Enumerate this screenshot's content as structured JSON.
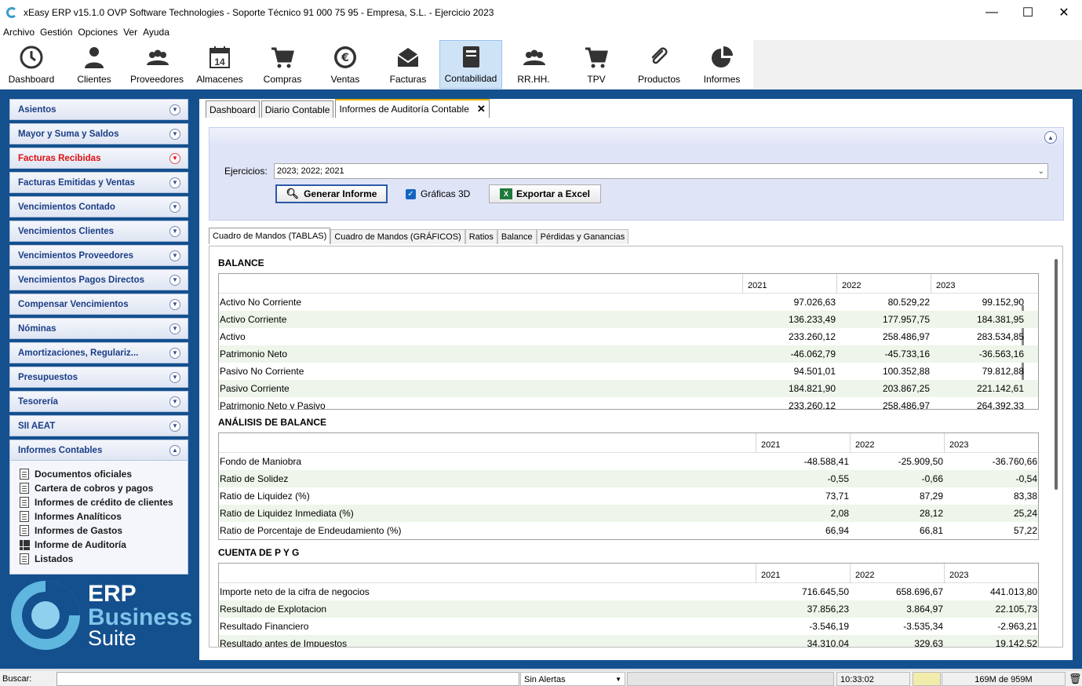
{
  "window": {
    "title": "xEasy ERP v15.1.0 OVP Software Technologies - Soporte Técnico 91 000 75 95 - Empresa, S.L. - Ejercicio 2023",
    "minimize": "—",
    "maximize": "☐",
    "close": "✕"
  },
  "menu": [
    "Archivo",
    "Gestión",
    "Opciones",
    "Ver",
    "Ayuda"
  ],
  "toolbar": [
    {
      "label": "Dashboard",
      "icon": "clock-icon"
    },
    {
      "label": "Clientes",
      "icon": "person-icon"
    },
    {
      "label": "Proveedores",
      "icon": "people-icon"
    },
    {
      "label": "Almacenes",
      "icon": "calendar-icon",
      "day": "14"
    },
    {
      "label": "Compras",
      "icon": "cart-icon"
    },
    {
      "label": "Ventas",
      "icon": "euro-icon"
    },
    {
      "label": "Facturas",
      "icon": "envelope-icon"
    },
    {
      "label": "Contabilidad",
      "icon": "ledger-icon",
      "active": true
    },
    {
      "label": "RR.HH.",
      "icon": "team-icon"
    },
    {
      "label": "TPV",
      "icon": "cart-icon"
    },
    {
      "label": "Productos",
      "icon": "paperclip-icon"
    },
    {
      "label": "Informes",
      "icon": "pie-chart-icon"
    }
  ],
  "sidebar": {
    "items": [
      {
        "label": "Asientos"
      },
      {
        "label": "Mayor y Suma y Saldos"
      },
      {
        "label": "Facturas Recibidas",
        "highlight": "#e01010"
      },
      {
        "label": "Facturas Emitidas y Ventas"
      },
      {
        "label": "Vencimientos Contado"
      },
      {
        "label": "Vencimientos Clientes"
      },
      {
        "label": "Vencimientos Proveedores"
      },
      {
        "label": "Vencimientos Pagos Directos"
      },
      {
        "label": "Compensar Vencimientos"
      },
      {
        "label": "Nóminas"
      },
      {
        "label": "Amortizaciones, Regulariz..."
      },
      {
        "label": "Presupuestos"
      },
      {
        "label": "Tesorería"
      },
      {
        "label": "SII AEAT"
      }
    ],
    "expanded": {
      "label": "Informes Contables",
      "links": [
        {
          "label": "Documentos oficiales",
          "icon": "document-icon"
        },
        {
          "label": "Cartera de cobros y pagos",
          "icon": "document-icon"
        },
        {
          "label": "Informes de crédito de clientes",
          "icon": "document-icon"
        },
        {
          "label": "Informes Analíticos",
          "icon": "document-icon"
        },
        {
          "label": "Informes de Gastos",
          "icon": "document-icon"
        },
        {
          "label": "Informe de Auditoría",
          "icon": "grid-icon"
        },
        {
          "label": "Listados",
          "icon": "document-icon"
        }
      ]
    }
  },
  "logo": {
    "line1": "ERP",
    "line2": "Business",
    "line3": "Suite"
  },
  "tabs": [
    {
      "label": "Dashboard"
    },
    {
      "label": "Diario Contable"
    },
    {
      "label": "Informes de Auditoría Contable",
      "active": true,
      "close": "✕"
    }
  ],
  "filters": {
    "ejercicios_label": "Ejercicios:",
    "ejercicios_value": "2023; 2022; 2021",
    "generate_label": "Generar Informe",
    "graficas_label": "Gráficas 3D",
    "graficas_checked": true,
    "export_label": "Exportar a Excel"
  },
  "subtabs": [
    {
      "label": "Cuadro de Mandos (TABLAS)",
      "active": true
    },
    {
      "label": "Cuadro de Mandos (GRÁFICOS)"
    },
    {
      "label": "Ratios"
    },
    {
      "label": "Balance"
    },
    {
      "label": "Pérdidas y Ganancias"
    }
  ],
  "sections": [
    {
      "title": "BALANCE",
      "years": [
        "2021",
        "2022",
        "2023"
      ],
      "rows": [
        {
          "label": "Activo No Corriente",
          "values": [
            "97.026,63",
            "80.529,22",
            "99.152,90"
          ]
        },
        {
          "label": "Activo Corriente",
          "values": [
            "136.233,49",
            "177.957,75",
            "184.381,95"
          ]
        },
        {
          "label": "Activo",
          "values": [
            "233.260,12",
            "258.486,97",
            "283.534,85"
          ]
        },
        {
          "label": "Patrimonio Neto",
          "values": [
            "-46.062,79",
            "-45.733,16",
            "-36.563,16"
          ]
        },
        {
          "label": "Pasivo No Corriente",
          "values": [
            "94.501,01",
            "100.352,88",
            "79.812,88"
          ]
        },
        {
          "label": "Pasivo Corriente",
          "values": [
            "184.821,90",
            "203.867,25",
            "221.142,61"
          ]
        },
        {
          "label": "Patrimonio Neto y Pasivo",
          "values": [
            "233.260,12",
            "258.486,97",
            "264.392,33"
          ]
        }
      ]
    },
    {
      "title": "ANÁLISIS DE BALANCE",
      "years": [
        "2021",
        "2022",
        "2023"
      ],
      "rows": [
        {
          "label": "Fondo de Maniobra",
          "values": [
            "-48.588,41",
            "-25.909,50",
            "-36.760,66"
          ]
        },
        {
          "label": "Ratio de Solidez",
          "values": [
            "-0,55",
            "-0,66",
            "-0,54"
          ]
        },
        {
          "label": "Ratio de Liquidez (%)",
          "values": [
            "73,71",
            "87,29",
            "83,38"
          ]
        },
        {
          "label": "Ratio de Liquidez Inmediata (%)",
          "values": [
            "2,08",
            "28,12",
            "25,24"
          ]
        },
        {
          "label": "Ratio de Porcentaje de Endeudamiento (%)",
          "values": [
            "66,94",
            "66,81",
            "57,22"
          ]
        }
      ]
    },
    {
      "title": "CUENTA DE P Y G",
      "years": [
        "2021",
        "2022",
        "2023"
      ],
      "rows": [
        {
          "label": "Importe neto de la cifra de negocios",
          "values": [
            "716.645,50",
            "658.696,67",
            "441.013,80"
          ]
        },
        {
          "label": "Resultado de Explotacion",
          "values": [
            "37.856,23",
            "3.864,97",
            "22.105,73"
          ]
        },
        {
          "label": "Resultado Financiero",
          "values": [
            "-3.546,19",
            "-3.535,34",
            "-2.963,21"
          ]
        },
        {
          "label": "Resultado antes de Impuestos",
          "values": [
            "34.310,04",
            "329,63",
            "19.142,52"
          ]
        }
      ]
    }
  ],
  "status": {
    "search_label": "Buscar:",
    "alerts": "Sin Alertas",
    "time": "10:33:02",
    "memory": "169M de 959M"
  }
}
